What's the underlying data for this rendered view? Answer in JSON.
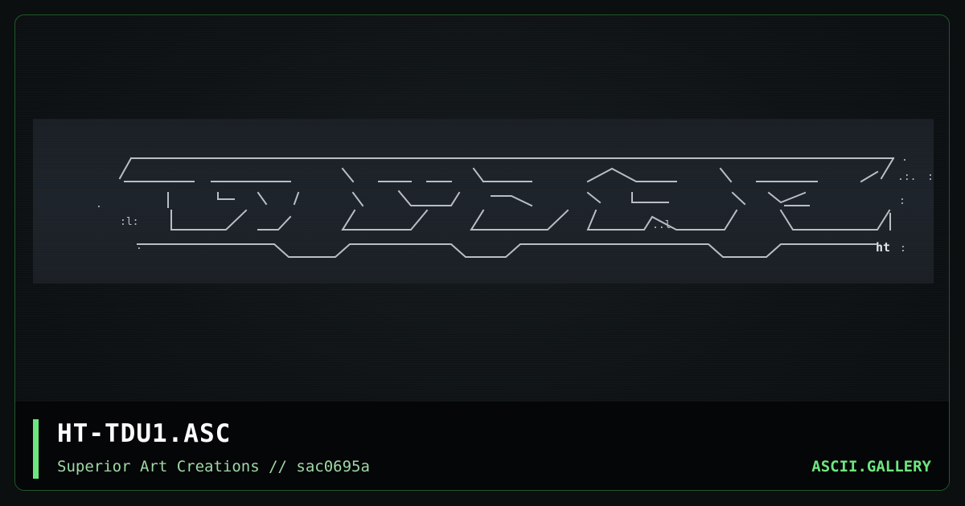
{
  "card": {
    "title": "HT-TDU1.ASC",
    "subtitle": "Superior Art Creations // sac0695a",
    "brand": "ASCII.GALLERY"
  },
  "art": {
    "signature": "ht",
    "colors": {
      "line": "#b9bec4",
      "accent": "#6ee67f",
      "panel": "#1c2127"
    }
  }
}
